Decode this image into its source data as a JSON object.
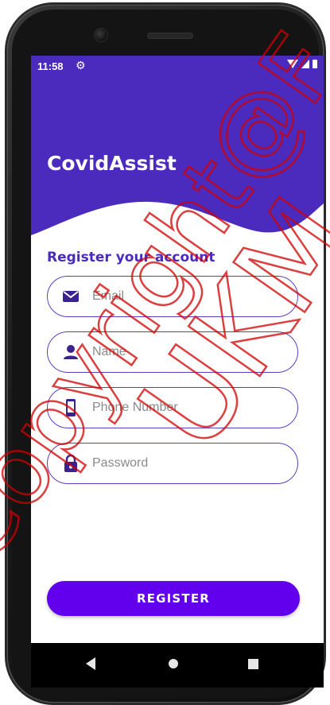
{
  "status_bar": {
    "time": "11:58",
    "settings_icon": "gear-icon"
  },
  "header": {
    "app_title": "CovidAssist"
  },
  "form": {
    "title": "Register your account",
    "fields": [
      {
        "icon": "email-icon",
        "placeholder": "Email",
        "value": ""
      },
      {
        "icon": "person-icon",
        "placeholder": "Name",
        "value": ""
      },
      {
        "icon": "phone-icon",
        "placeholder": "Phone Number",
        "value": ""
      },
      {
        "icon": "lock-icon",
        "placeholder": "Password",
        "value": ""
      }
    ],
    "register_label": "REGISTER"
  },
  "watermark": {
    "text_1": "Copyright@F",
    "text_2": "UKM"
  },
  "colors": {
    "primary": "#4a2bbd",
    "button": "#6200ee"
  }
}
